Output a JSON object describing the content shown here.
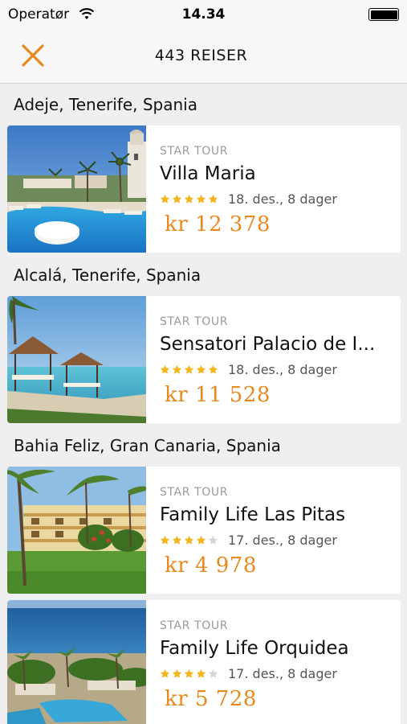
{
  "status": {
    "carrier": "Operatør",
    "time": "14.34"
  },
  "nav": {
    "title": "443 REISER"
  },
  "colors": {
    "accent": "#e8891f",
    "star_on": "#f2b51d",
    "star_off": "#d6d6d6"
  },
  "sections": [
    {
      "header": "Adeje, Tenerife, Spania",
      "hotels": [
        {
          "brand": "STAR TOUR",
          "name": "Villa Maria",
          "stars": 5,
          "date": "18. des., 8 dager",
          "price": "kr 12 378"
        }
      ]
    },
    {
      "header": "Alcalá, Tenerife, Spania",
      "hotels": [
        {
          "brand": "STAR TOUR",
          "name": "Sensatori Palacio de I...",
          "stars": 5,
          "date": "18. des., 8 dager",
          "price": "kr 11 528"
        }
      ]
    },
    {
      "header": "Bahia Feliz, Gran Canaria, Spania",
      "hotels": [
        {
          "brand": "STAR TOUR",
          "name": "Family Life Las Pitas",
          "stars": 4,
          "date": "17. des., 8 dager",
          "price": "kr 4 978"
        },
        {
          "brand": "STAR TOUR",
          "name": "Family Life Orquidea",
          "stars": 4,
          "date": "17. des., 8 dager",
          "price": "kr 5 728"
        }
      ]
    }
  ]
}
